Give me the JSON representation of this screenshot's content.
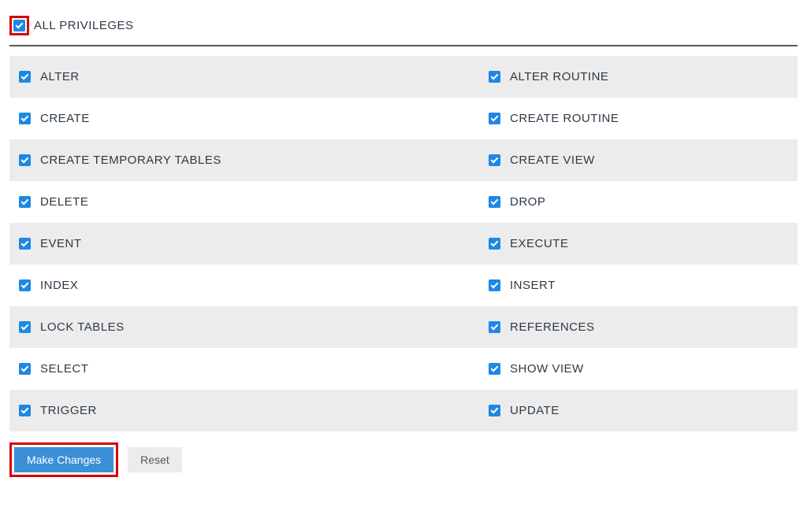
{
  "header": {
    "all_privileges_label": "ALL PRIVILEGES"
  },
  "rows": [
    {
      "left": "ALTER",
      "right": "ALTER ROUTINE"
    },
    {
      "left": "CREATE",
      "right": "CREATE ROUTINE"
    },
    {
      "left": "CREATE TEMPORARY TABLES",
      "right": "CREATE VIEW"
    },
    {
      "left": "DELETE",
      "right": "DROP"
    },
    {
      "left": "EVENT",
      "right": "EXECUTE"
    },
    {
      "left": "INDEX",
      "right": "INSERT"
    },
    {
      "left": "LOCK TABLES",
      "right": "REFERENCES"
    },
    {
      "left": "SELECT",
      "right": "SHOW VIEW"
    },
    {
      "left": "TRIGGER",
      "right": "UPDATE"
    }
  ],
  "buttons": {
    "make_changes": "Make Changes",
    "reset": "Reset"
  }
}
